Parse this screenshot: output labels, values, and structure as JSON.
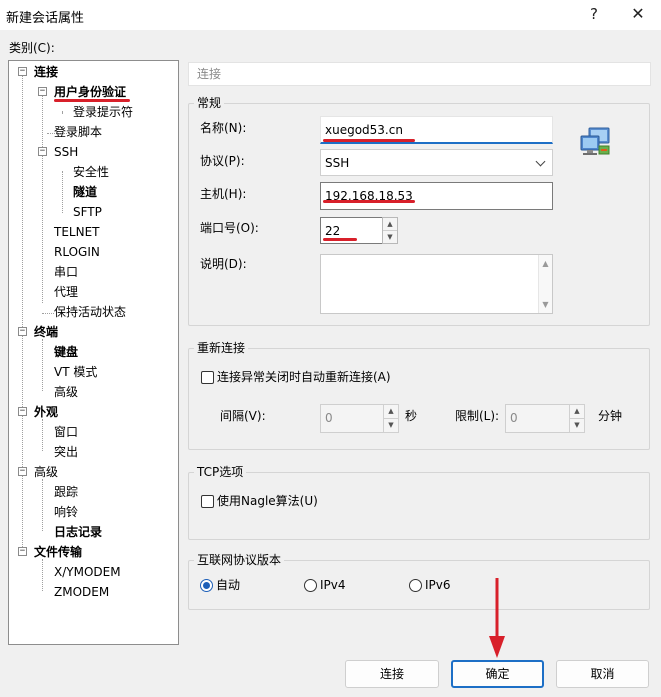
{
  "window": {
    "title": "新建会话属性",
    "help_label": "?",
    "close_label": "✕"
  },
  "category_label": "类别(C):",
  "tree": {
    "items": [
      {
        "label": "连接",
        "bold": true
      },
      {
        "label": "用户身份验证",
        "bold": true,
        "selected": true
      },
      {
        "label": "登录提示符"
      },
      {
        "label": "登录脚本"
      },
      {
        "label": "SSH"
      },
      {
        "label": "安全性"
      },
      {
        "label": "隧道",
        "bold": true
      },
      {
        "label": "SFTP"
      },
      {
        "label": "TELNET"
      },
      {
        "label": "RLOGIN"
      },
      {
        "label": "串口"
      },
      {
        "label": "代理"
      },
      {
        "label": "保持活动状态"
      },
      {
        "label": "终端",
        "bold": true
      },
      {
        "label": "键盘",
        "bold": true
      },
      {
        "label": "VT 模式"
      },
      {
        "label": "高级"
      },
      {
        "label": "外观",
        "bold": true
      },
      {
        "label": "窗口"
      },
      {
        "label": "突出"
      },
      {
        "label": "高级"
      },
      {
        "label": "跟踪"
      },
      {
        "label": "响铃"
      },
      {
        "label": "日志记录",
        "bold": true
      },
      {
        "label": "文件传输",
        "bold": true
      },
      {
        "label": "X/YMODEM"
      },
      {
        "label": "ZMODEM"
      }
    ]
  },
  "panel_header": "连接",
  "general": {
    "title": "常规",
    "name_label": "名称(N):",
    "name_value": "xuegod53.cn",
    "protocol_label": "协议(P):",
    "protocol_value": "SSH",
    "host_label": "主机(H):",
    "host_value": "192.168.18.53",
    "port_label": "端口号(O):",
    "port_value": "22",
    "desc_label": "说明(D):",
    "desc_value": ""
  },
  "reconnect": {
    "title": "重新连接",
    "auto_label": "连接异常关闭时自动重新连接(A)",
    "interval_label": "间隔(V):",
    "interval_value": "0",
    "interval_unit": "秒",
    "limit_label": "限制(L):",
    "limit_value": "0",
    "limit_unit": "分钟"
  },
  "tcp": {
    "title": "TCP选项",
    "nagle_label": "使用Nagle算法(U)"
  },
  "ip_version": {
    "title": "互联网协议版本",
    "options": [
      "自动",
      "IPv4",
      "IPv6"
    ],
    "selected": "自动"
  },
  "buttons": {
    "connect": "连接",
    "ok": "确定",
    "cancel": "取消"
  },
  "colors": {
    "annotation_red": "#d8202a",
    "accent_blue": "#1d6fc6"
  }
}
